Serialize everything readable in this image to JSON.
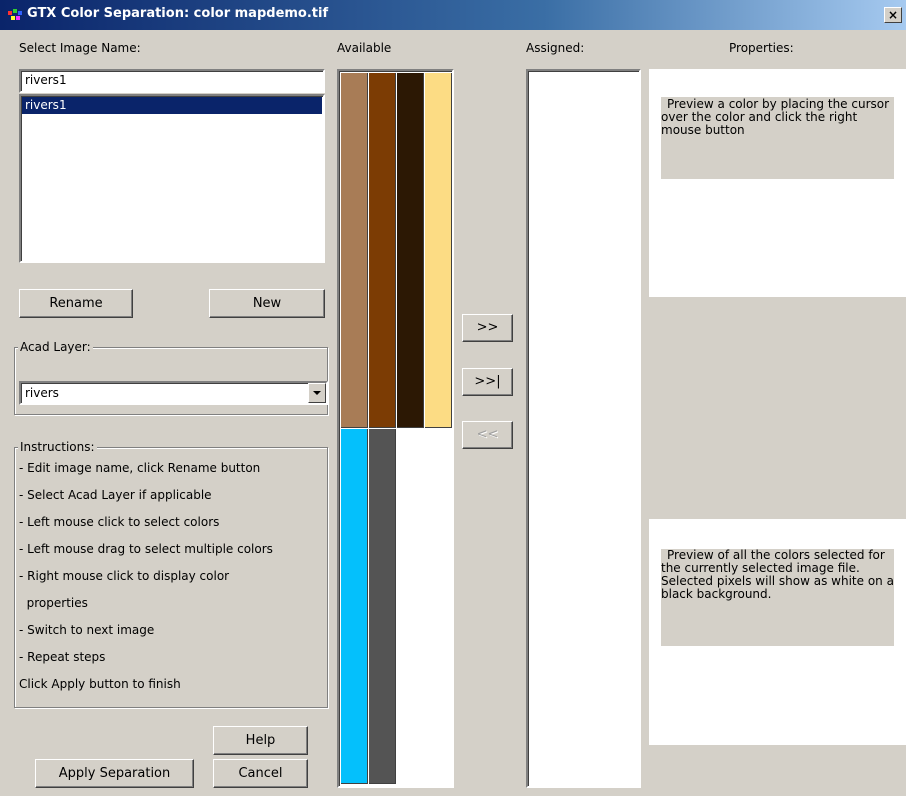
{
  "window": {
    "title": "GTX Color Separation: color mapdemo.tif",
    "close": "×"
  },
  "labels": {
    "select_image": "Select Image Name:",
    "available": "Available",
    "assigned": "Assigned:",
    "properties": "Properties:"
  },
  "image_name": {
    "value": "rivers1"
  },
  "image_list": [
    "rivers1"
  ],
  "buttons": {
    "rename": "Rename",
    "new": "New",
    "add": ">>",
    "add_all": ">>|",
    "remove": "<<",
    "help": "Help",
    "apply": "Apply Separation",
    "cancel": "Cancel"
  },
  "acad_layer": {
    "legend": "Acad Layer:",
    "selected": "rivers"
  },
  "instructions": {
    "legend": "Instructions:",
    "lines": [
      "- Edit image name, click Rename button",
      "- Select Acad Layer if applicable",
      "- Left mouse click to select colors",
      "- Left mouse drag to select multiple colors",
      "- Right mouse click to display color",
      "  properties",
      "- Switch to next image",
      "- Repeat steps",
      "Click Apply button to finish"
    ]
  },
  "swatches": [
    "#a87c56",
    "#7c3c04",
    "#2c1804",
    "#fcdc84",
    "#04c0fc",
    "#545454"
  ],
  "properties": {
    "preview_color_text": "Preview a color by placing the cursor over the color and click the right mouse button",
    "preview_all_text": "Preview of all the colors selected for the currently selected image file. Selected pixels will show as white on a black background."
  }
}
